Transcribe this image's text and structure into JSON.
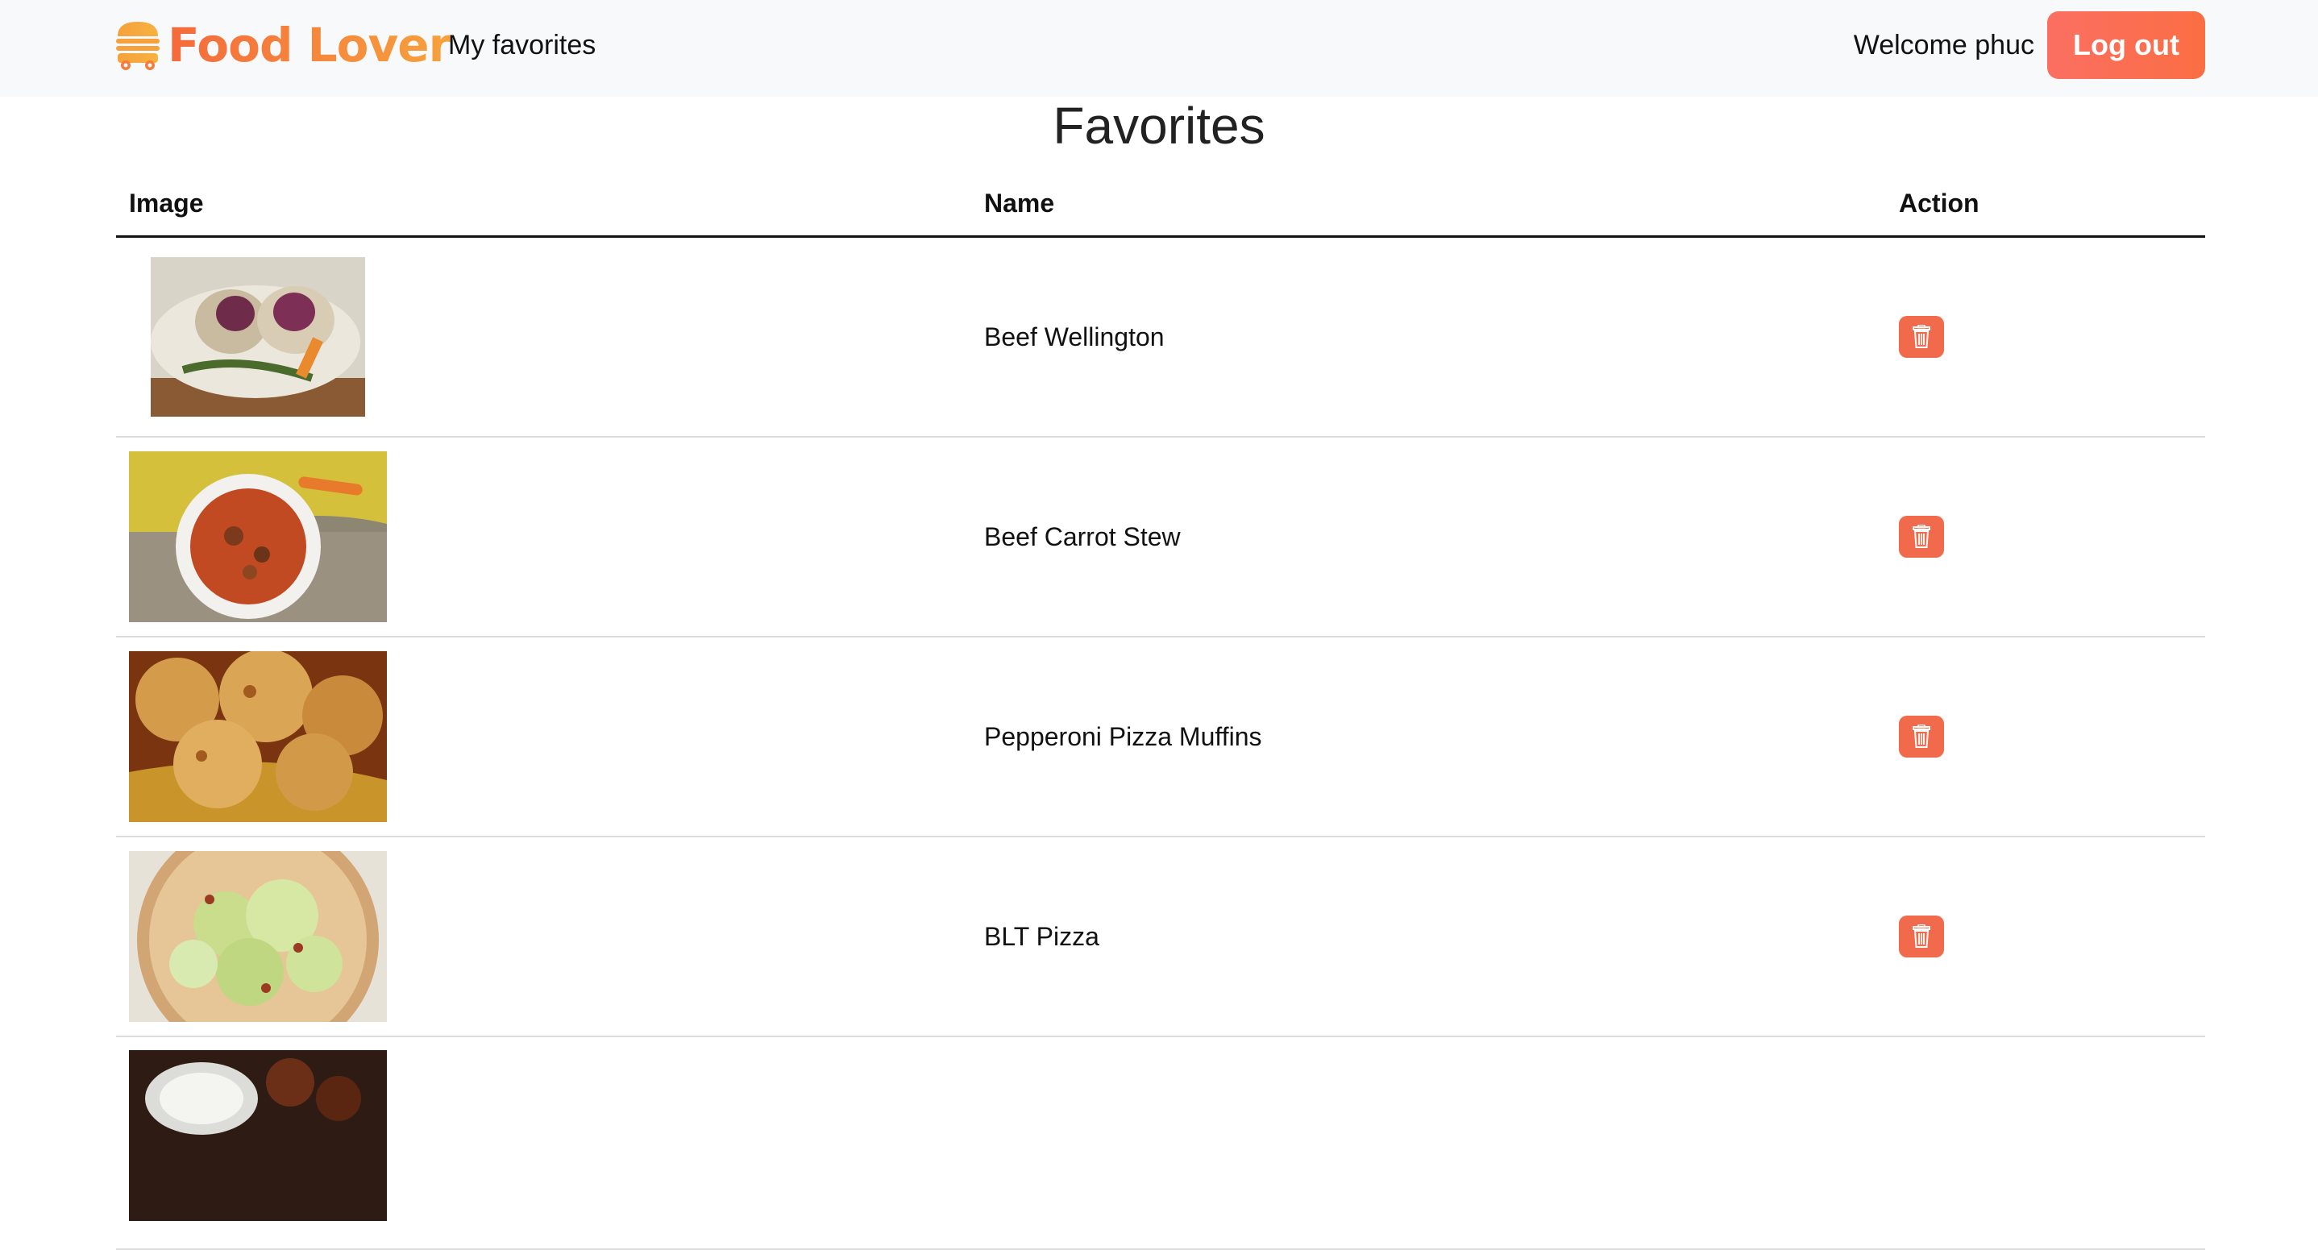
{
  "header": {
    "brand_name": "Food Lover",
    "nav_link": "My favorites",
    "welcome_text": "Welcome phuc",
    "logout_label": "Log out",
    "brand_icon": "burger-icon"
  },
  "page": {
    "title": "Favorites"
  },
  "table": {
    "columns": [
      "Image",
      "Name",
      "Action"
    ],
    "rows": [
      {
        "name": "Beef Wellington",
        "image": "beef-wellington-photo",
        "action_icon": "trash-icon"
      },
      {
        "name": "Beef Carrot Stew",
        "image": "beef-carrot-stew-photo",
        "action_icon": "trash-icon"
      },
      {
        "name": "Pepperoni Pizza Muffins",
        "image": "pepperoni-pizza-muffins-photo",
        "action_icon": "trash-icon"
      },
      {
        "name": "BLT Pizza",
        "image": "blt-pizza-photo",
        "action_icon": "trash-icon"
      },
      {
        "name": "",
        "image": "partial-dish-photo"
      }
    ]
  },
  "colors": {
    "accent": "#fb6e43",
    "delete": "#f26a4c",
    "navbar_bg": "#f8f9fa"
  }
}
